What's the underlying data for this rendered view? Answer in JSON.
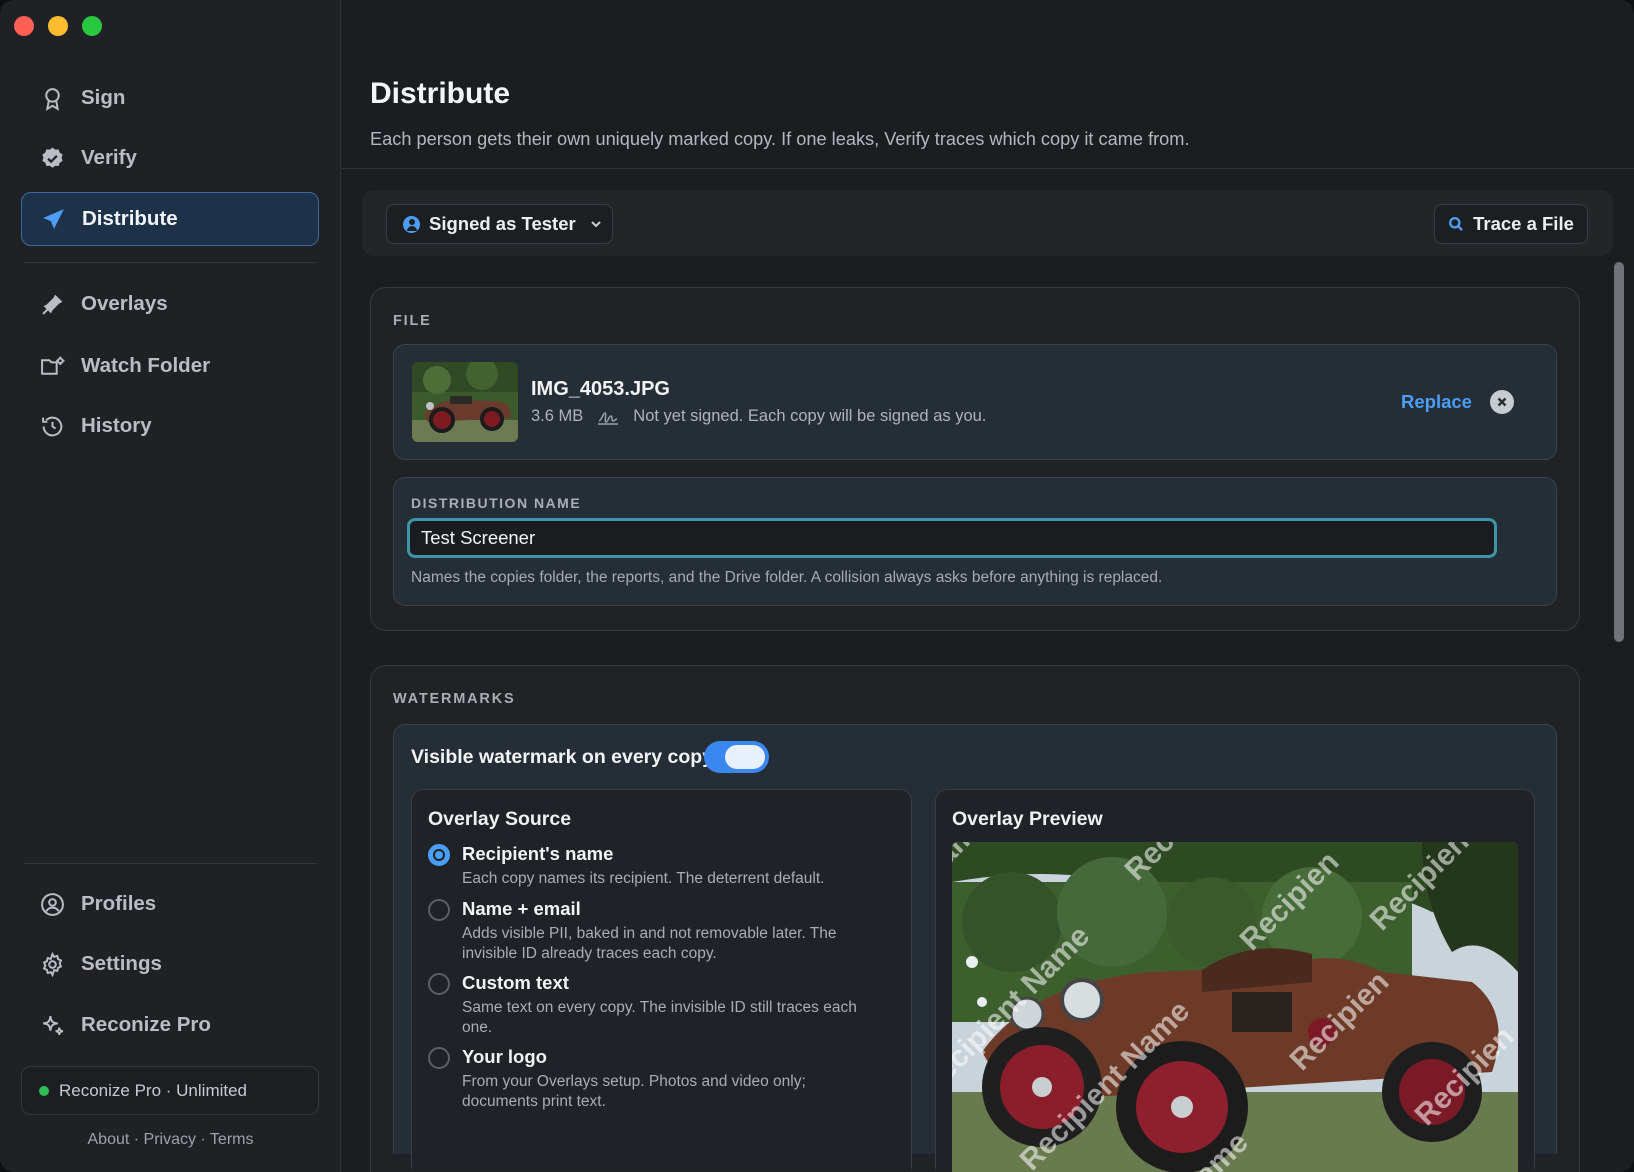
{
  "sidebar": {
    "nav_top": [
      {
        "label": "Sign",
        "icon": "award-icon"
      },
      {
        "label": "Verify",
        "icon": "verified-badge-icon"
      },
      {
        "label": "Distribute",
        "icon": "send-icon",
        "active": true
      },
      {
        "label": "Overlays",
        "icon": "stamp-icon"
      },
      {
        "label": "Watch Folder",
        "icon": "watch-folder-icon"
      },
      {
        "label": "History",
        "icon": "history-icon"
      }
    ],
    "nav_bottom": [
      {
        "label": "Profiles",
        "icon": "user-circle-icon"
      },
      {
        "label": "Settings",
        "icon": "gear-icon"
      },
      {
        "label": "Reconize Pro",
        "icon": "sparkle-icon"
      }
    ],
    "plan": "Reconize Pro · Unlimited",
    "footer": {
      "about": "About",
      "privacy": "Privacy",
      "terms": "Terms",
      "sep": " · "
    }
  },
  "header": {
    "title": "Distribute",
    "subtitle": "Each person gets their own uniquely marked copy. If one leaks, Verify traces which copy it came from."
  },
  "toolbar": {
    "signed_as": "Signed as Tester",
    "trace_label": "Trace a File"
  },
  "file_section": {
    "label": "FILE",
    "file_name": "IMG_4053.JPG",
    "file_size": "3.6 MB",
    "sign_status": "Not yet signed. Each copy will be signed as you.",
    "replace_label": "Replace"
  },
  "distribution": {
    "label": "DISTRIBUTION NAME",
    "value": "Test Screener",
    "hint": "Names the copies folder, the reports, and the Drive folder. A collision always asks before anything is replaced."
  },
  "watermarks": {
    "label": "WATERMARKS",
    "toggle_label": "Visible watermark on every copy",
    "toggle_on": true,
    "overlay_source": {
      "title": "Overlay Source",
      "options": [
        {
          "title": "Recipient's name",
          "desc": "Each copy names its recipient. The deterrent default.",
          "selected": true
        },
        {
          "title": "Name + email",
          "desc": "Adds visible PII, baked in and not removable later. The invisible ID already traces each copy.",
          "selected": false
        },
        {
          "title": "Custom text",
          "desc": "Same text on every copy. The invisible ID still traces each one.",
          "selected": false
        },
        {
          "title": "Your logo",
          "desc": "From your Overlays setup. Photos and video only; documents print text.",
          "selected": false
        }
      ]
    },
    "overlay_preview": {
      "title": "Overlay Preview",
      "watermark_fragments": [
        "Nam",
        "Recipi",
        "Recipien",
        "Recipient Name",
        "Recipient Name",
        "Recipien",
        "Recipien",
        "Recipien",
        "Name"
      ]
    }
  },
  "colors": {
    "accent": "#4a9ef5",
    "focus_ring": "#3e94a8",
    "status_green": "#2fbf5a"
  }
}
